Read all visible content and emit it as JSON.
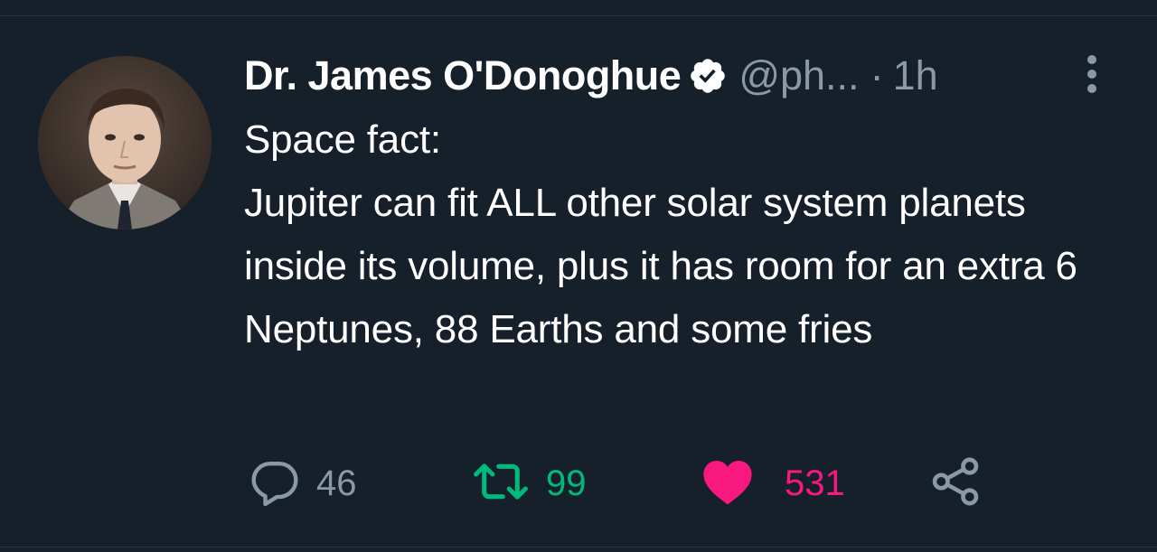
{
  "tweet": {
    "author": {
      "display_name": "Dr. James O'Donoghue",
      "handle": "@ph...",
      "verified_icon": "verified-badge-icon",
      "avatar": "avatar"
    },
    "separator": "·",
    "time": "1h",
    "text": "Space fact:\nJupiter can fit ALL other solar system planets inside its volume, plus it has room for an extra 6 Neptunes, 88 Earths and some fries",
    "actions": {
      "reply": {
        "icon": "reply-icon",
        "count": "46"
      },
      "retweet": {
        "icon": "retweet-icon",
        "count": "99"
      },
      "like": {
        "icon": "heart-icon",
        "count": "531"
      },
      "share": {
        "icon": "share-icon"
      }
    },
    "more_icon": "more-options-icon"
  },
  "colors": {
    "background": "#15202b",
    "secondary_text": "#8b98a5",
    "retweet_green": "#00ba7c",
    "like_pink": "#f91880"
  }
}
